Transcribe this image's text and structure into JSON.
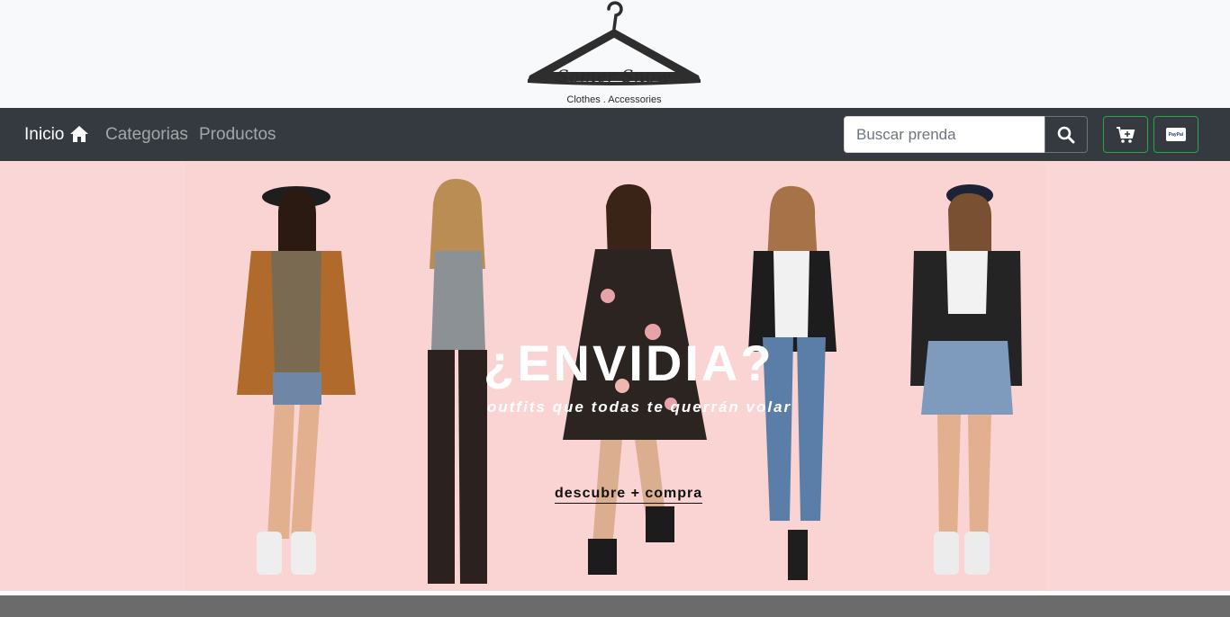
{
  "brand": {
    "name": "Somer Snow",
    "tagline": "Clothes . Accessories"
  },
  "nav": {
    "home_label": "Inicio",
    "categories_label": "Categorias",
    "products_label": "Productos"
  },
  "search": {
    "placeholder": "Buscar prenda",
    "value": ""
  },
  "icons": {
    "logo": "hanger-icon",
    "home": "home-icon",
    "search": "search-icon",
    "cart": "cart-plus-icon",
    "paypal": "paypal-icon"
  },
  "hero": {
    "title": "¿ENVIDIA?",
    "subtitle": "outfits que todas te querrán volar",
    "cta_label": "descubre + compra"
  },
  "paypal_label": "PayPal",
  "colors": {
    "navbar": "#343a40",
    "header_bg": "#f8f9fa",
    "hero_bg": "#f9d4d3",
    "accent_green": "#28a745",
    "footer_bar": "#6b6b6b"
  }
}
